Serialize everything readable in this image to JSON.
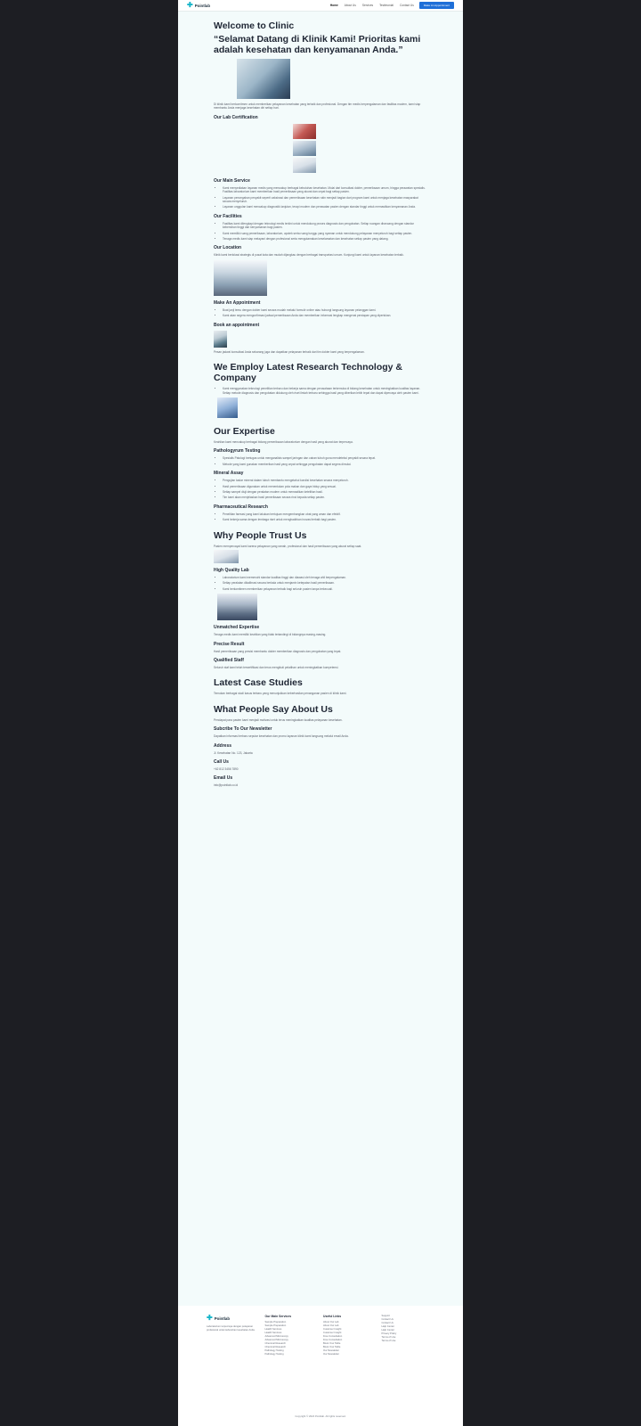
{
  "nav": {
    "brand": "Pointlab",
    "links": [
      "Home",
      "About Us",
      "Services",
      "Testimonial",
      "Contact Us"
    ],
    "cta": "Make An Appointment"
  },
  "intro": {
    "title": "Welcome to Clinic",
    "quote": "“Selamat Datang di Klinik Kami! Prioritas kami adalah kesehatan dan kenyamanan Anda.”",
    "text": "Di klinik kami berkomitmen untuk memberikan pelayanan kesehatan yang terbaik dan profesional. Dengan tim medis berpengalaman dan fasilitas modern, kami siap membantu Anda menjaga kesehatan diri setiap hari."
  },
  "certification": {
    "title": "Our Lab Certification"
  },
  "service": {
    "title": "Our Main Service",
    "items": [
      "Kami menyediakan layanan medis yang mencakup berbagai kebutuhan kesehatan. Mulai dari konsultasi dokter, pemeriksaan umum, hingga perawatan spesialis. Fasilitas laboratorium kami memberikan hasil pemeriksaan yang akurat dan cepat bagi setiap pasien.",
      "Layanan pencegahan penyakit seperti vaksinasi dan pemeriksaan kesehatan rutin menjadi bagian dari program kami untuk menjaga kesehatan masyarakat secara menyeluruh.",
      "Layanan unggulan kami mencakup diagnostik lanjutan, terapi modern dan perawatan pasien dengan standar tinggi untuk memastikan kenyamanan Anda."
    ]
  },
  "facilities": {
    "title": "Our Facilities",
    "items": [
      "Fasilitas kami dilengkapi dengan teknologi medis terkini untuk mendukung proses diagnosis dan pengobatan. Setiap ruangan dirancang dengan standar kebersihan tinggi dan kenyamanan bagi pasien.",
      "Kami memiliki ruang pemeriksaan, laboratorium, apotek serta ruang tunggu yang nyaman untuk mendukung pelayanan menyeluruh bagi setiap pasien.",
      "Tenaga medis kami siap melayani dengan profesional serta mengutamakan keselamatan dan kesehatan setiap pasien yang datang."
    ]
  },
  "location": {
    "title": "Our Location",
    "text": "Klinik kami berlokasi strategis di pusat kota dan mudah dijangkau dengan berbagai transportasi umum. Kunjungi kami untuk layanan kesehatan terbaik."
  },
  "appointment": {
    "title": "Make An Appointment",
    "items": [
      "Buat janji temu dengan dokter kami secara mudah melalui formulir online atau hubungi langsung layanan pelanggan kami.",
      "Kami akan segera mengonfirmasi jadwal pemeriksaan Anda dan memberikan informasi lengkap mengenai persiapan yang diperlukan."
    ]
  },
  "book": {
    "title": "Book an appointment",
    "text": "Pesan jadwal konsultasi Anda sekarang juga dan dapatkan pelayanan terbaik dari tim dokter kami yang berpengalaman."
  },
  "research": {
    "title": "We Employ Latest Research Technology & Company",
    "items": [
      "Kami menggunakan teknologi penelitian terbaru dan bekerja sama dengan perusahaan terkemuka di bidang kesehatan untuk meningkatkan kualitas layanan. Setiap metode diagnosis dan pengobatan didukung oleh riset ilmiah terbaru sehingga hasil yang diberikan lebih tepat dan dapat dipercaya oleh pasien kami."
    ]
  },
  "expertise": {
    "title": "Our Expertise",
    "text": "Keahlian kami mencakup berbagai bidang pemeriksaan laboratorium dengan hasil yang akurat dan terpercaya.",
    "pathology": {
      "title": "Pathologyrum Testing",
      "items": [
        "Spesialis Patologi bertugas untuk menganalisis sampel jaringan dan cairan tubuh guna mendeteksi penyakit secara tepat.",
        "Metode yang kami gunakan memberikan hasil yang cepat sehingga pengobatan dapat segera dimulai."
      ]
    },
    "mineral": {
      "title": "Mineral Assay",
      "items": [
        "Pengujian kadar mineral dalam tubuh membantu mengetahui kondisi kesehatan secara menyeluruh.",
        "Hasil pemeriksaan digunakan untuk menentukan pola makan dan gaya hidup yang sesuai.",
        "Setiap sampel diuji dengan peralatan modern untuk memastikan ketelitian hasil.",
        "Tim kami akan menjelaskan hasil pemeriksaan secara rinci kepada setiap pasien."
      ]
    },
    "pharma": {
      "title": "Pharmaceutical Research",
      "items": [
        "Penelitian farmasi yang kami lakukan bertujuan mengembangkan obat yang aman dan efektif.",
        "Kami bekerja sama dengan lembaga riset untuk menghadirkan inovasi terbaik bagi pasien."
      ]
    }
  },
  "trust": {
    "title": "Why People Trust Us",
    "text": "Pasien mempercayai kami karena pelayanan yang ramah, profesional dan hasil pemeriksaan yang akurat setiap saat.",
    "quality": {
      "title": "High Quality Lab",
      "items": [
        "Laboratorium kami memenuhi standar kualitas tinggi dan diawasi oleh tenaga ahli berpengalaman.",
        "Setiap peralatan dikalibrasi secara berkala untuk menjamin ketepatan hasil pemeriksaan.",
        "Kami berkomitmen memberikan pelayanan terbaik bagi seluruh pasien tanpa terkecuali."
      ]
    },
    "expertise": {
      "title": "Unmatched Expertise",
      "text": "Tenaga medis kami memiliki keahlian yang tidak tertandingi di bidangnya masing-masing."
    },
    "precise": {
      "title": "Precise Result",
      "text": "Hasil pemeriksaan yang presisi membantu dokter memberikan diagnosis dan pengobatan yang tepat."
    },
    "staff": {
      "title": "Qualified Staff",
      "text": "Seluruh staf kami telah tersertifikasi dan terus mengikuti pelatihan untuk meningkatkan kompetensi."
    }
  },
  "cases": {
    "title": "Latest Case Studies",
    "text": "Temukan berbagai studi kasus terbaru yang menunjukkan keberhasilan penanganan pasien di klinik kami."
  },
  "testimonial": {
    "title": "What People Say About Us",
    "text": "Pendapat para pasien kami menjadi motivasi untuk terus meningkatkan kualitas pelayanan kesehatan."
  },
  "newsletter": {
    "title": "Subcribe To Our Newsletter",
    "text": "Dapatkan informasi terbaru seputar kesehatan dan promo layanan klinik kami langsung melalui email Anda."
  },
  "contact": {
    "address_label": "Address",
    "address": "Jl. Kesehatan No. 123, Jakarta",
    "call_label": "Call Us",
    "phone": "+62 812 3456 7890",
    "email_label": "Email Us",
    "email": "info@pointlab.co.id"
  },
  "footer": {
    "brand": "Pointlab",
    "about": "Laboratorium terpercaya dengan pelayanan profesional untuk kebutuhan kesehatan Anda.",
    "col1_title": "Our Main Services",
    "col1": [
      "Sample Preparation",
      "Sample Preparation",
      "Health Services",
      "Health Services",
      "Advanced Microscopy",
      "Advanced Microscopy",
      "Chemical Research",
      "Chemical Research",
      "Pathology Testing",
      "Pathology Testing"
    ],
    "col2_title": "Useful Links",
    "col2": [
      "About Our Lab",
      "About Our Lab",
      "Customer Insight",
      "Customer Insight",
      "Free Consultation",
      "Free Consultation",
      "Book Your Table",
      "Book Your Table",
      "Our Newsletter",
      "Our Newsletter"
    ],
    "col3_title": "Support",
    "col3": [
      "Support",
      "Contact Us",
      "Contact Us",
      "Help Center",
      "Help Center",
      "Privacy Policy",
      "Terms of Use",
      "Terms of Use"
    ],
    "copyright": "Copyright © 2024 Pointlab. All rights reserved."
  }
}
